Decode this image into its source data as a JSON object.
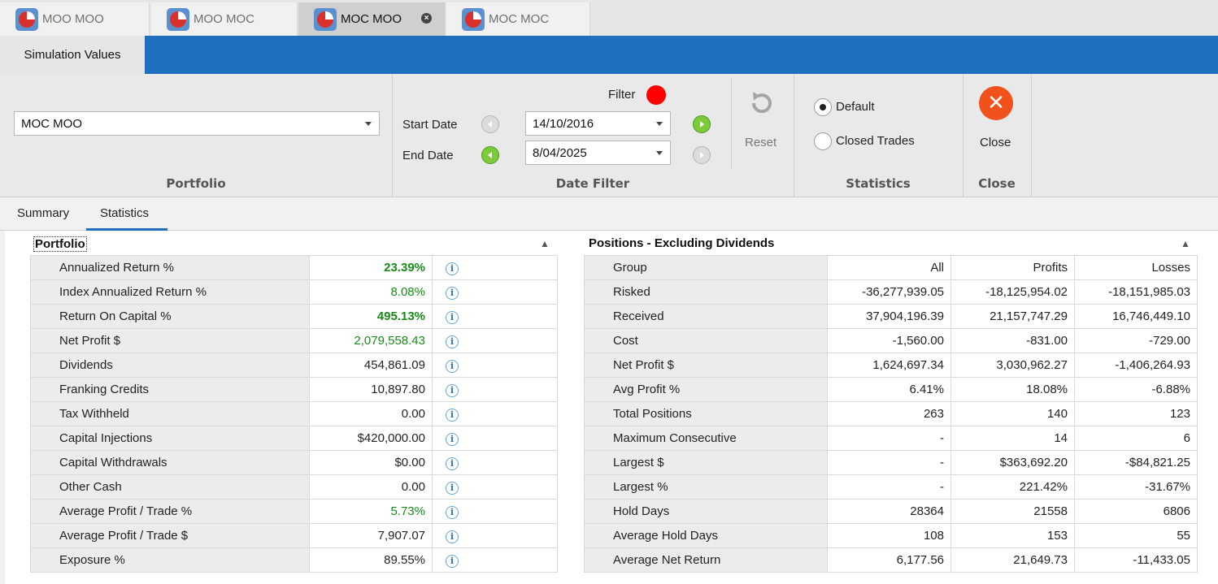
{
  "doc_tabs": [
    {
      "label": "MOO MOO",
      "active": false
    },
    {
      "label": "MOO MOC",
      "active": false
    },
    {
      "label": "MOC MOO",
      "active": true
    },
    {
      "label": "MOC MOC",
      "active": false
    }
  ],
  "ribbon": {
    "tab_label": "Simulation Values",
    "portfolio": {
      "value": "MOC MOO",
      "caption": "Portfolio"
    },
    "date_filter": {
      "filter_label": "Filter",
      "start_label": "Start Date",
      "start_value": "14/10/2016",
      "end_label": "End Date",
      "end_value": "8/04/2025",
      "reset_label": "Reset",
      "caption": "Date Filter"
    },
    "statistics": {
      "default_label": "Default",
      "closed_label": "Closed Trades",
      "caption": "Statistics"
    },
    "close": {
      "label": "Close",
      "caption": "Close"
    }
  },
  "sub_tabs": {
    "summary": "Summary",
    "statistics": "Statistics"
  },
  "portfolio_panel": {
    "title": "Portfolio",
    "rows": [
      {
        "label": "Annualized Return %",
        "value": "23.39%"
      },
      {
        "label": "Index Annualized Return %",
        "value": "8.08%"
      },
      {
        "label": "Return On Capital %",
        "value": "495.13%"
      },
      {
        "label": "Net Profit $",
        "value": "2,079,558.43"
      },
      {
        "label": "Dividends",
        "value": "454,861.09"
      },
      {
        "label": "Franking Credits",
        "value": "10,897.80"
      },
      {
        "label": "Tax Withheld",
        "value": "0.00"
      },
      {
        "label": "Capital Injections",
        "value": "$420,000.00"
      },
      {
        "label": "Capital Withdrawals",
        "value": "$0.00"
      },
      {
        "label": "Other Cash",
        "value": "0.00"
      },
      {
        "label": "Average Profit / Trade %",
        "value": "5.73%"
      },
      {
        "label": "Average Profit / Trade $",
        "value": "7,907.07"
      },
      {
        "label": "Exposure %",
        "value": "89.55%"
      }
    ]
  },
  "positions_panel": {
    "title": "Positions - Excluding Dividends",
    "headers": [
      "Group",
      "All",
      "Profits",
      "Losses"
    ],
    "rows": [
      {
        "label": "Risked",
        "all": "-36,277,939.05",
        "profits": "-18,125,954.02",
        "losses": "-18,151,985.03"
      },
      {
        "label": "Received",
        "all": "37,904,196.39",
        "profits": "21,157,747.29",
        "losses": "16,746,449.10"
      },
      {
        "label": "Cost",
        "all": "-1,560.00",
        "profits": "-831.00",
        "losses": "-729.00"
      },
      {
        "label": "Net Profit $",
        "all": "1,624,697.34",
        "profits": "3,030,962.27",
        "losses": "-1,406,264.93"
      },
      {
        "label": "Avg Profit %",
        "all": "6.41%",
        "profits": "18.08%",
        "losses": "-6.88%"
      },
      {
        "label": "Total Positions",
        "all": "263",
        "profits": "140",
        "losses": "123"
      },
      {
        "label": "Maximum Consecutive",
        "all": "-",
        "profits": "14",
        "losses": "6"
      },
      {
        "label": "Largest $",
        "all": "-",
        "profits": "$363,692.20",
        "losses": "-$84,821.25"
      },
      {
        "label": "Largest %",
        "all": "-",
        "profits": "221.42%",
        "losses": "-31.67%"
      },
      {
        "label": "Hold Days",
        "all": "28364",
        "profits": "21558",
        "losses": "6806"
      },
      {
        "label": "Average Hold Days",
        "all": "108",
        "profits": "153",
        "losses": "55"
      },
      {
        "label": "Average Net Return",
        "all": "6,177.56",
        "profits": "21,649.73",
        "losses": "-11,433.05"
      }
    ]
  },
  "colors": {
    "ribbon_blue": "#1e6fbe",
    "positive_green": "#1a8a1a",
    "filter_red": "#ff0000",
    "close_orange": "#f1511b"
  }
}
